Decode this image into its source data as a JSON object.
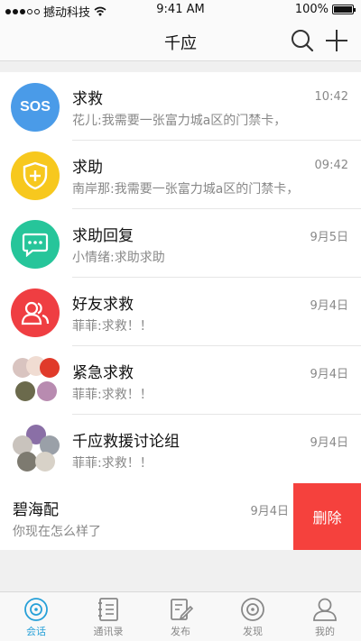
{
  "status_bar": {
    "carrier": "撼动科技",
    "time": "9:41 AM",
    "battery": "100%"
  },
  "nav": {
    "title": "千应",
    "search_icon": "search-icon",
    "add_icon": "plus-icon"
  },
  "conversations": [
    {
      "name": "求救",
      "time": "10:42",
      "preview": "花儿:我需要一张富力城a区的门禁卡，",
      "avatar": {
        "type": "sos",
        "text": "SOS",
        "color": "#4a9be8"
      }
    },
    {
      "name": "求助",
      "time": "09:42",
      "preview": "南岸那:我需要一张富力城a区的门禁卡，",
      "avatar": {
        "type": "shield-plus-icon",
        "color": "#f7c81e"
      }
    },
    {
      "name": "求助回复",
      "time": "9月5日",
      "preview": "小情绪:求助求助",
      "avatar": {
        "type": "chat-bubble-icon",
        "color": "#26c59a"
      }
    },
    {
      "name": "好友求救",
      "time": "9月4日",
      "preview": "菲菲:求救！！",
      "avatar": {
        "type": "people-icon",
        "color": "#ef3e42"
      }
    },
    {
      "name": "紧急求救",
      "time": "9月4日",
      "preview": "菲菲:求救！！",
      "avatar": {
        "type": "group-photos"
      }
    },
    {
      "name": "千应救援讨论组",
      "time": "9月4日",
      "preview": "菲菲:求救！！",
      "avatar": {
        "type": "group-photos"
      }
    }
  ],
  "swiped_conversation": {
    "name": "碧海配",
    "time": "9月4日",
    "preview": "你现在怎么样了",
    "delete_label": "删除"
  },
  "tabs": [
    {
      "label": "会话",
      "icon": "chat-circle-icon",
      "active": true
    },
    {
      "label": "通讯录",
      "icon": "contacts-book-icon",
      "active": false
    },
    {
      "label": "发布",
      "icon": "compose-icon",
      "active": false
    },
    {
      "label": "发现",
      "icon": "discover-icon",
      "active": false
    },
    {
      "label": "我的",
      "icon": "profile-icon",
      "active": false
    }
  ],
  "colors": {
    "accent": "#27a0d8",
    "delete": "#f5413d"
  }
}
